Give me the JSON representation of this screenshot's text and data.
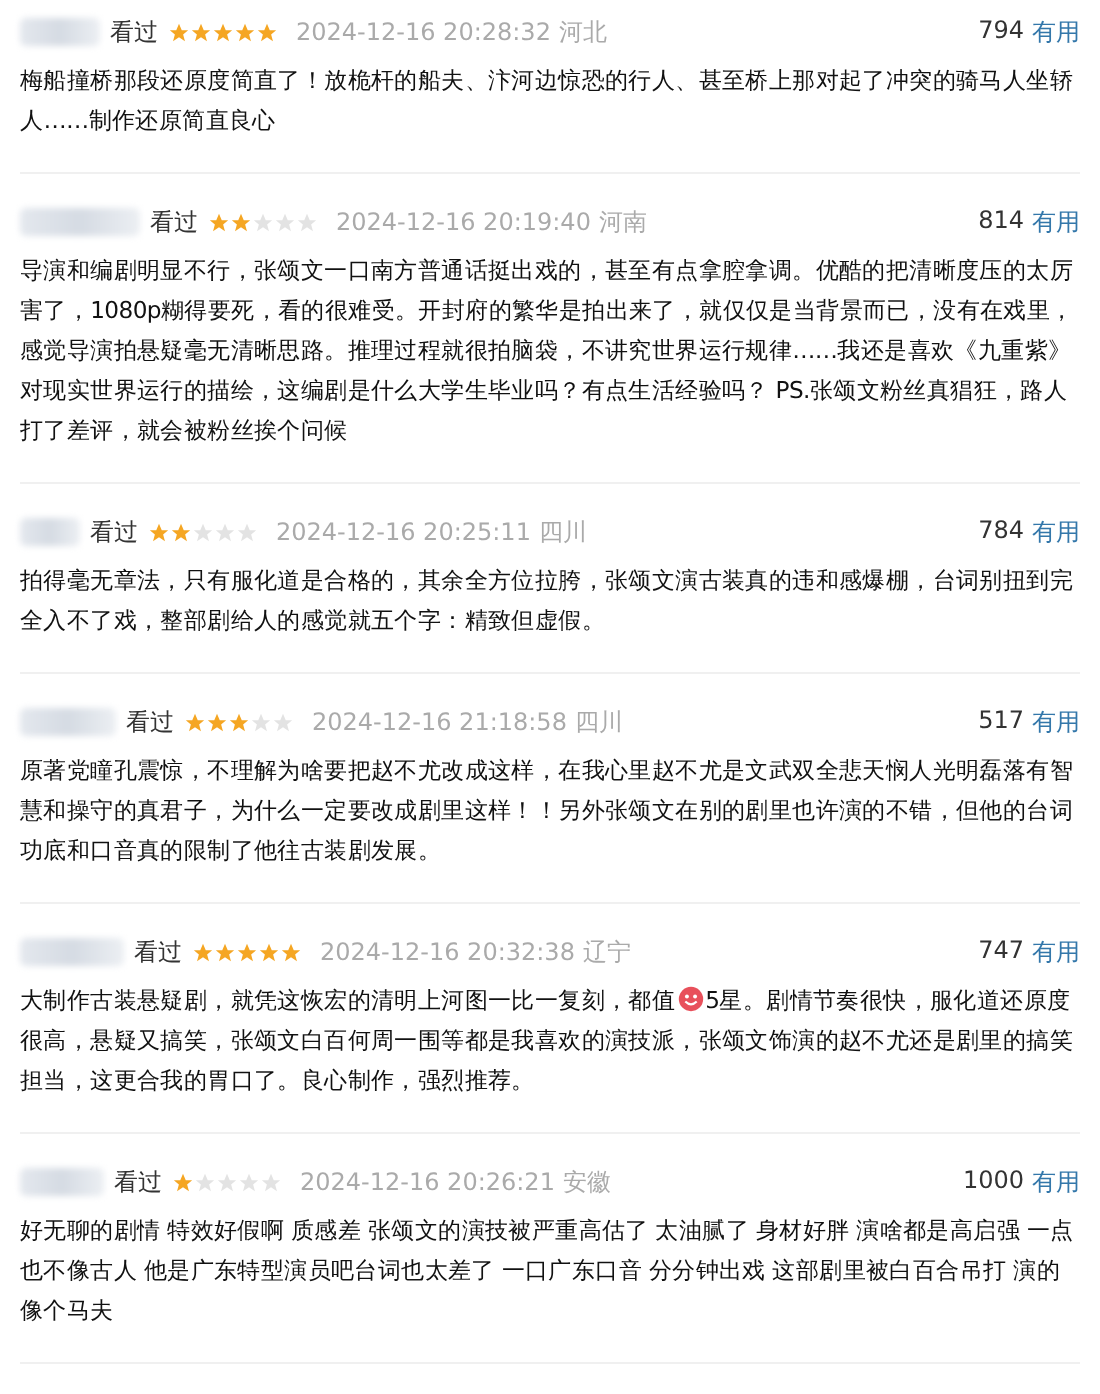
{
  "reviews": [
    {
      "status": "看过",
      "stars": 5,
      "time": "2024-12-16 20:28:32",
      "location": "河北",
      "useful_count": "794",
      "useful_label": "有用",
      "text": "梅船撞桥那段还原度简直了！放桅杆的船夫、汴河边惊恐的行人、甚至桥上那对起了冲突的骑马人坐轿人……制作还原简直良心"
    },
    {
      "status": "看过",
      "stars": 2,
      "time": "2024-12-16 20:19:40",
      "location": "河南",
      "useful_count": "814",
      "useful_label": "有用",
      "text": "导演和编剧明显不行，张颂文一口南方普通话挺出戏的，甚至有点拿腔拿调。优酷的把清晰度压的太厉害了，1080p糊得要死，看的很难受。开封府的繁华是拍出来了，就仅仅是当背景而已，没有在戏里，感觉导演拍悬疑毫无清晰思路。推理过程就很拍脑袋，不讲究世界运行规律……我还是喜欢《九重紫》对现实世界运行的描绘，这编剧是什么大学生毕业吗？有点生活经验吗？ PS.张颂文粉丝真猖狂，路人打了差评，就会被粉丝挨个问候"
    },
    {
      "status": "看过",
      "stars": 2,
      "time": "2024-12-16 20:25:11",
      "location": "四川",
      "useful_count": "784",
      "useful_label": "有用",
      "text": "拍得毫无章法，只有服化道是合格的，其余全方位拉胯，张颂文演古装真的违和感爆棚，台词别扭到完全入不了戏，整部剧给人的感觉就五个字：精致但虚假。"
    },
    {
      "status": "看过",
      "stars": 3,
      "time": "2024-12-16 21:18:58",
      "location": "四川",
      "useful_count": "517",
      "useful_label": "有用",
      "text": "原著党瞳孔震惊，不理解为啥要把赵不尤改成这样，在我心里赵不尤是文武双全悲天悯人光明磊落有智慧和操守的真君子，为什么一定要改成剧里这样！！另外张颂文在别的剧里也许演的不错，但他的台词功底和口音真的限制了他往古装剧发展。"
    },
    {
      "status": "看过",
      "stars": 5,
      "time": "2024-12-16 20:32:38",
      "location": "辽宁",
      "useful_count": "747",
      "useful_label": "有用",
      "text": "大制作古装悬疑剧，就凭这恢宏的清明上河图一比一复刻，都值",
      "text_after_emoji": "5星。剧情节奏很快，服化道还原度很高，悬疑又搞笑，张颂文白百何周一围等都是我喜欢的演技派，张颂文饰演的赵不尤还是剧里的搞笑担当，这更合我的胃口了。良心制作，强烈推荐。"
    },
    {
      "status": "看过",
      "stars": 1,
      "time": "2024-12-16 20:26:21",
      "location": "安徽",
      "useful_count": "1000",
      "useful_label": "有用",
      "text": "好无聊的剧情 特效好假啊 质感差 张颂文的演技被严重高估了 太油腻了 身材好胖 演啥都是高启强 一点也不像古人 他是广东特型演员吧台词也太差了 一口广东口音 分分钟出戏 这部剧里被白百合吊打 演的像个马夫"
    }
  ]
}
